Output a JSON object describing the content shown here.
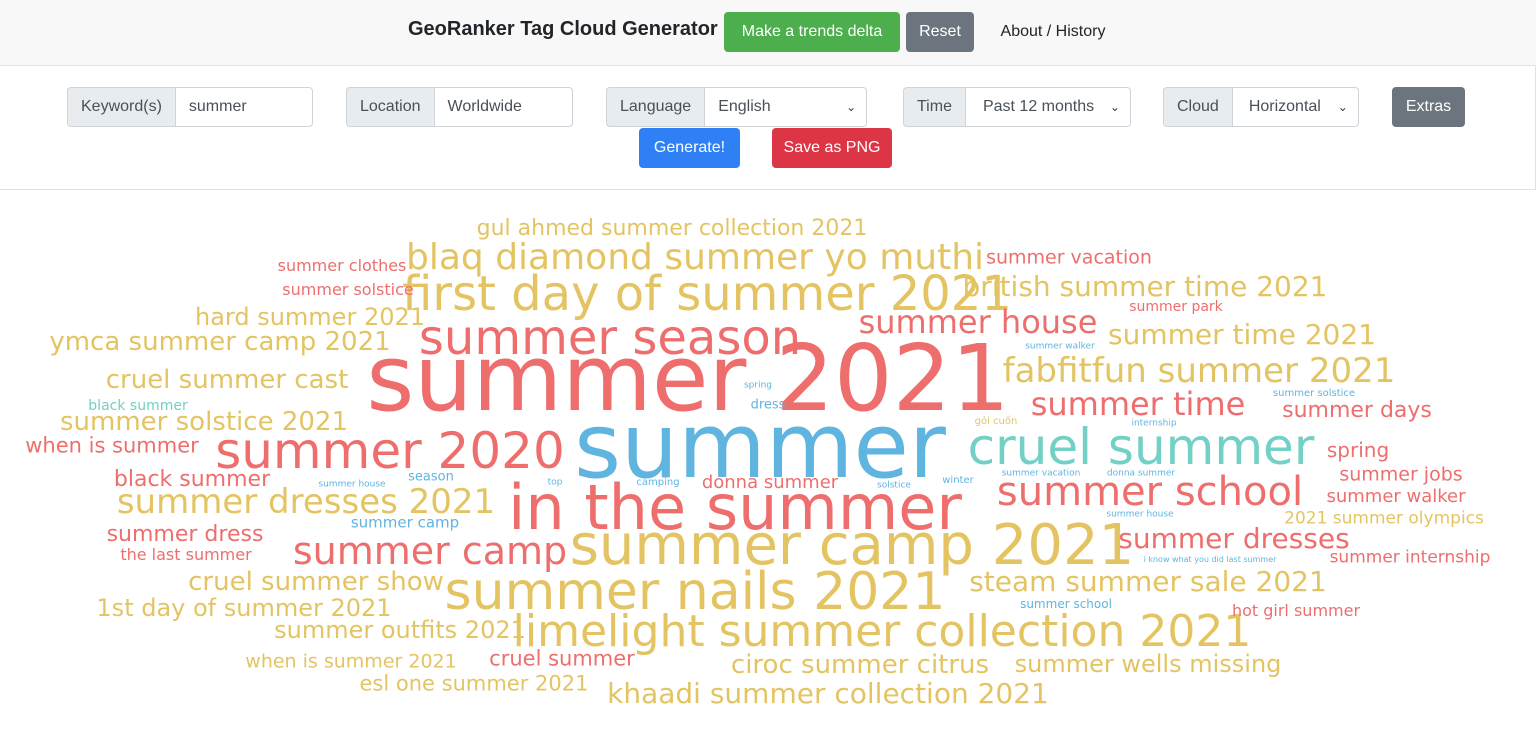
{
  "header": {
    "brand": "GeoRanker Tag Cloud Generator",
    "trends_delta_label": "Make a trends delta",
    "reset_label": "Reset",
    "about_label": "About / History"
  },
  "controls": {
    "keyword": {
      "label": "Keyword(s)",
      "value": "summer"
    },
    "location": {
      "label": "Location",
      "value": "Worldwide"
    },
    "language": {
      "label": "Language",
      "value": "English"
    },
    "time": {
      "label": "Time",
      "value": "Past 12 months"
    },
    "cloud": {
      "label": "Cloud",
      "value": "Horizontal"
    },
    "extras_label": "Extras",
    "generate_label": "Generate!",
    "save_png_label": "Save as PNG"
  },
  "colors": {
    "red": "#ee6e6e",
    "gold": "#e4c462",
    "blue": "#5fb4e0",
    "teal": "#72d0c4"
  },
  "words": [
    {
      "text": "summer 2021",
      "color": "red"
    },
    {
      "text": "summer",
      "color": "blue"
    },
    {
      "text": "in the summer",
      "color": "red"
    },
    {
      "text": "summer camp 2021",
      "color": "gold"
    },
    {
      "text": "summer season",
      "color": "red"
    },
    {
      "text": "first day of summer 2021",
      "color": "gold"
    },
    {
      "text": "summer 2020",
      "color": "red"
    },
    {
      "text": "summer nails 2021",
      "color": "gold"
    },
    {
      "text": "cruel summer",
      "color": "teal"
    },
    {
      "text": "limelight summer collection 2021",
      "color": "gold"
    },
    {
      "text": "blaq diamond summer yo muthi",
      "color": "gold"
    },
    {
      "text": "summer school",
      "color": "red"
    },
    {
      "text": "summer camp",
      "color": "red"
    },
    {
      "text": "summer dresses 2021",
      "color": "gold"
    },
    {
      "text": "summer house",
      "color": "red"
    },
    {
      "text": "fabfitfun summer 2021",
      "color": "gold"
    },
    {
      "text": "summer time",
      "color": "red"
    },
    {
      "text": "summer time 2021",
      "color": "gold"
    },
    {
      "text": "british summer time 2021",
      "color": "gold"
    },
    {
      "text": "steam summer sale 2021",
      "color": "gold"
    },
    {
      "text": "summer dresses",
      "color": "red"
    },
    {
      "text": "khaadi summer collection 2021",
      "color": "gold"
    },
    {
      "text": "ymca summer camp 2021",
      "color": "gold"
    },
    {
      "text": "cruel summer show",
      "color": "gold"
    },
    {
      "text": "ciroc summer citrus",
      "color": "gold"
    },
    {
      "text": "summer solstice 2021",
      "color": "gold"
    },
    {
      "text": "hard summer 2021",
      "color": "gold"
    },
    {
      "text": "cruel summer cast",
      "color": "gold"
    },
    {
      "text": "summer outfits 2021",
      "color": "gold"
    },
    {
      "text": "1st day of summer 2021",
      "color": "gold"
    },
    {
      "text": "summer wells missing",
      "color": "gold"
    },
    {
      "text": "summer days",
      "color": "red"
    },
    {
      "text": "gul ahmed summer collection 2021",
      "color": "gold"
    },
    {
      "text": "black summer",
      "color": "red"
    },
    {
      "text": "summer dress",
      "color": "red"
    },
    {
      "text": "cruel summer",
      "color": "red"
    },
    {
      "text": "when is summer",
      "color": "red"
    },
    {
      "text": "summer vacation",
      "color": "red"
    },
    {
      "text": "esl one summer 2021",
      "color": "gold"
    },
    {
      "text": "when is summer 2021",
      "color": "gold"
    },
    {
      "text": "spring",
      "color": "red"
    },
    {
      "text": "summer jobs",
      "color": "red"
    },
    {
      "text": "donna summer",
      "color": "red"
    },
    {
      "text": "summer walker",
      "color": "red"
    },
    {
      "text": "2021 summer olympics",
      "color": "gold"
    },
    {
      "text": "summer internship",
      "color": "red"
    },
    {
      "text": "summer clothes",
      "color": "red"
    },
    {
      "text": "summer solstice",
      "color": "red"
    },
    {
      "text": "the last summer",
      "color": "red"
    },
    {
      "text": "hot girl summer",
      "color": "red"
    },
    {
      "text": "summer park",
      "color": "red"
    },
    {
      "text": "black summer",
      "color": "teal"
    },
    {
      "text": "summer camp",
      "color": "blue"
    },
    {
      "text": "dress",
      "color": "blue"
    },
    {
      "text": "summer school",
      "color": "blue"
    },
    {
      "text": "season",
      "color": "blue"
    },
    {
      "text": "gỏi cuốn",
      "color": "gold"
    },
    {
      "text": "winter",
      "color": "blue"
    },
    {
      "text": "summer walker",
      "color": "blue"
    },
    {
      "text": "summer solstice",
      "color": "blue"
    },
    {
      "text": "internship",
      "color": "blue"
    },
    {
      "text": "summer house",
      "color": "blue"
    },
    {
      "text": "summer house",
      "color": "blue"
    },
    {
      "text": "spring",
      "color": "blue"
    },
    {
      "text": "top",
      "color": "blue"
    },
    {
      "text": "camping",
      "color": "blue"
    },
    {
      "text": "solstice",
      "color": "blue"
    },
    {
      "text": "summer vacation",
      "color": "blue"
    },
    {
      "text": "donna summer",
      "color": "blue"
    },
    {
      "text": "i know what you did last summer",
      "color": "blue"
    }
  ]
}
